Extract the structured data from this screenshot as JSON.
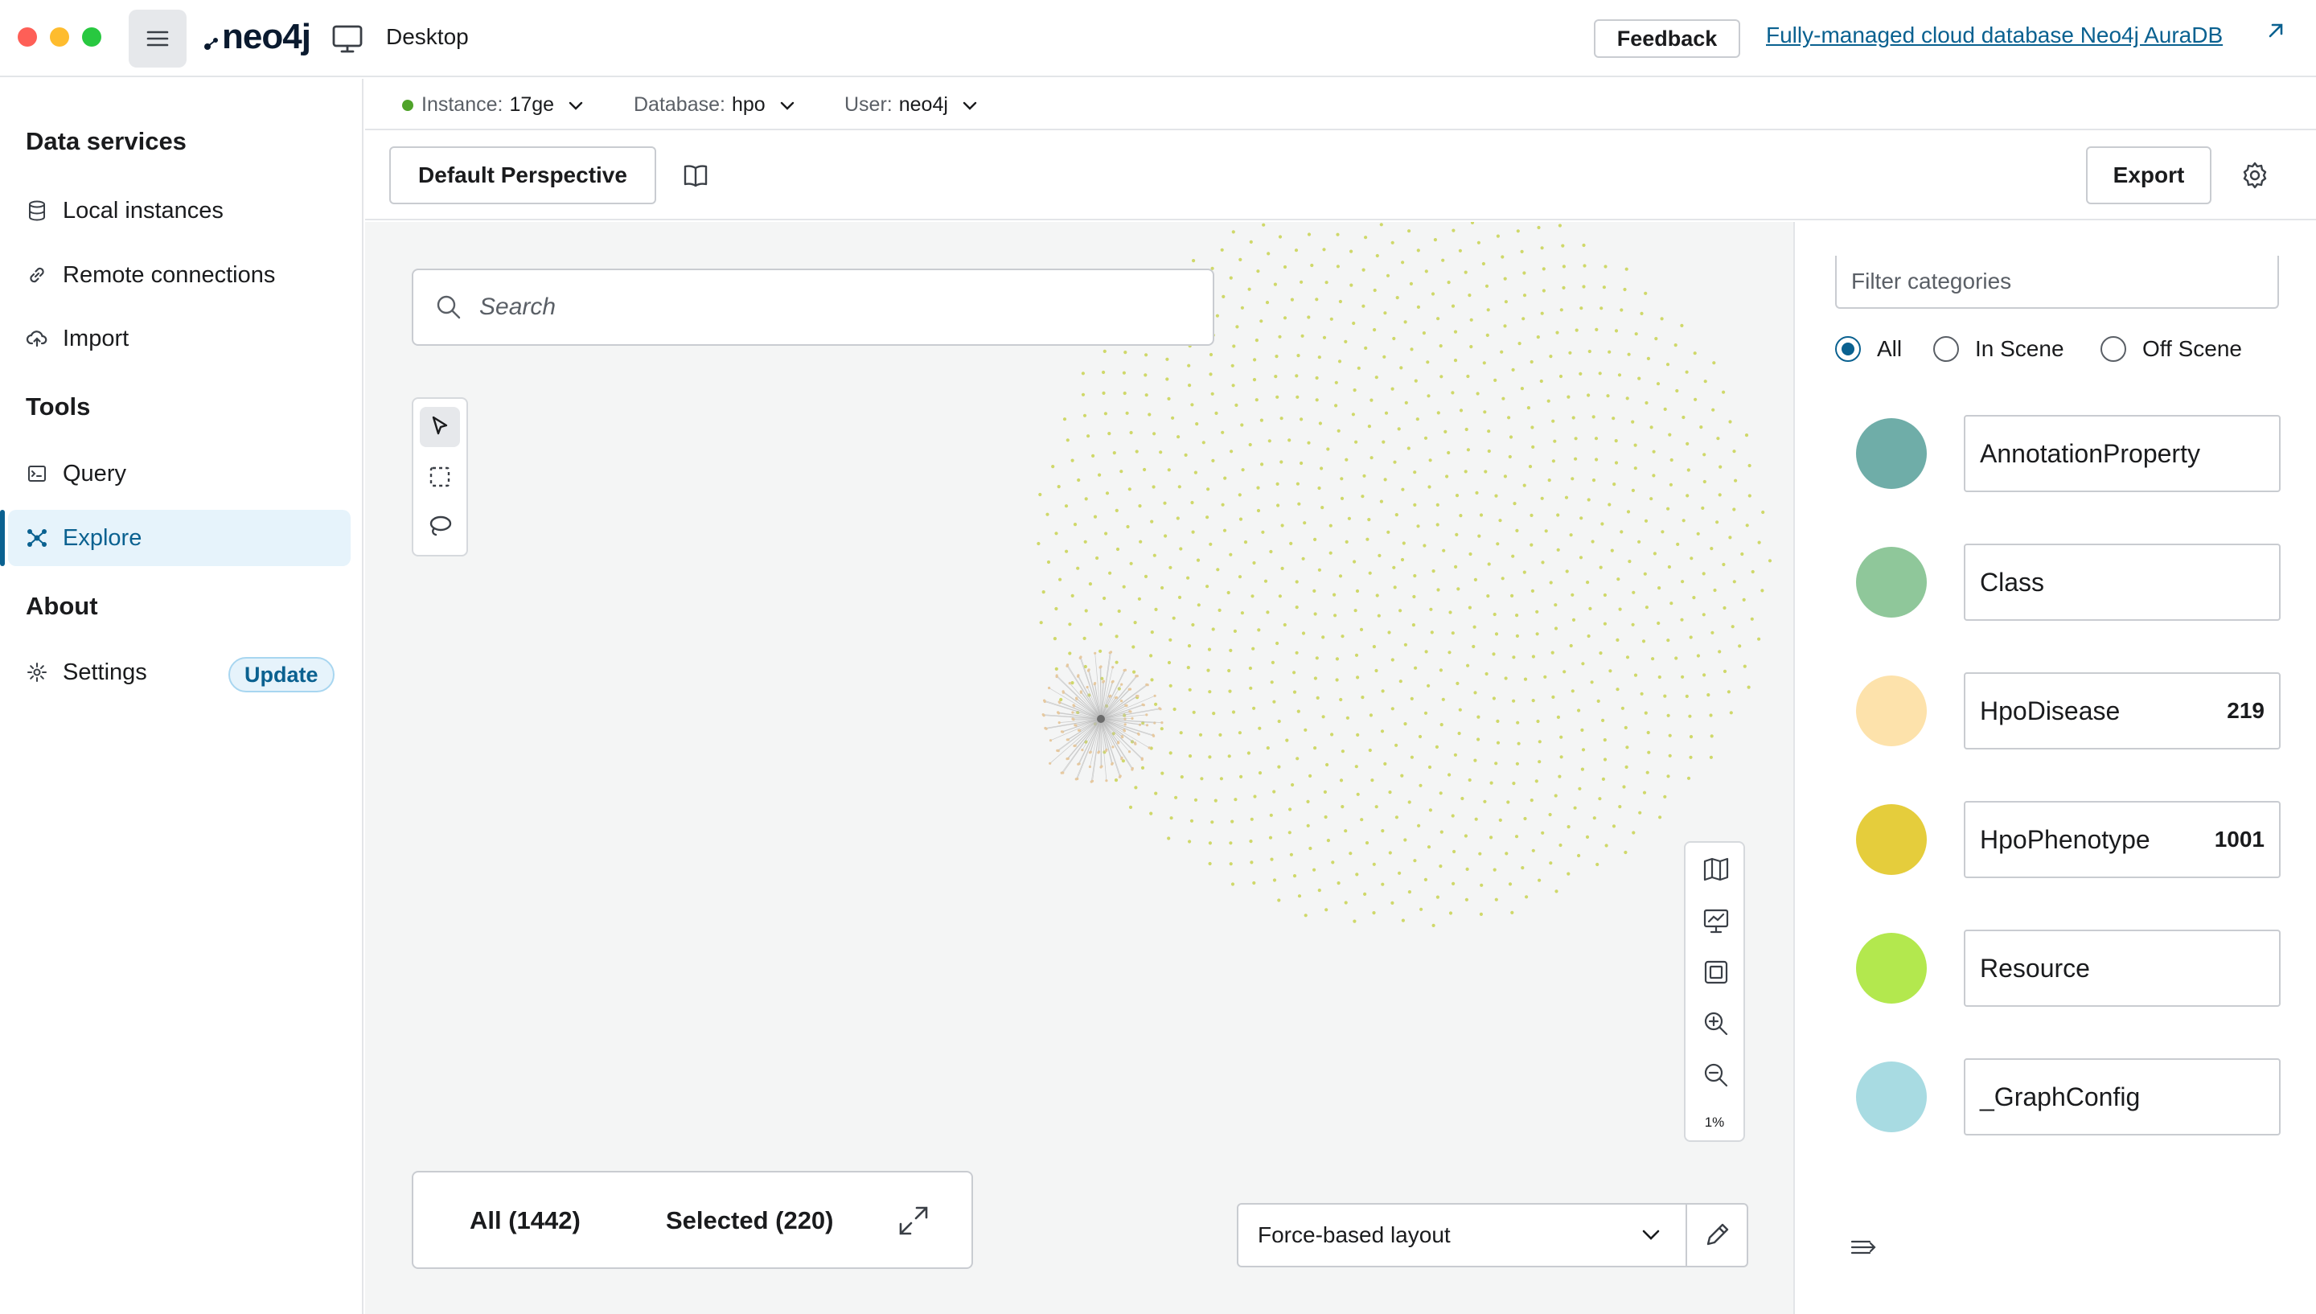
{
  "titlebar": {
    "app_name": "neo4j",
    "section_label": "Desktop",
    "feedback_label": "Feedback",
    "aura_link": "Fully-managed cloud database Neo4j AuraDB"
  },
  "sidebar": {
    "sections": [
      {
        "title": "Data services"
      },
      {
        "title": "Tools"
      },
      {
        "title": "About"
      }
    ],
    "items": [
      {
        "label": "Local instances",
        "icon": "database-icon"
      },
      {
        "label": "Remote connections",
        "icon": "link-icon"
      },
      {
        "label": "Import",
        "icon": "cloud-upload-icon"
      },
      {
        "label": "Query",
        "icon": "terminal-icon"
      },
      {
        "label": "Explore",
        "icon": "graph-icon",
        "active": true
      },
      {
        "label": "Settings",
        "icon": "gear-icon"
      }
    ],
    "update_badge": "Update"
  },
  "connection": {
    "instance_key": "Instance:",
    "instance_val": "17ge",
    "database_key": "Database:",
    "database_val": "hpo",
    "user_key": "User:",
    "user_val": "neo4j",
    "status_color": "#4fa32a"
  },
  "toolbar": {
    "perspective_label": "Default Perspective",
    "export_label": "Export"
  },
  "canvas": {
    "search_placeholder": "Search",
    "zoom_level": "1%",
    "count_all": "All (1442)",
    "count_selected": "Selected (220)",
    "layout_value": "Force-based layout"
  },
  "panel": {
    "filter_placeholder": "Filter categories",
    "radio_options": [
      {
        "label": "All",
        "checked": true
      },
      {
        "label": "In Scene",
        "checked": false
      },
      {
        "label": "Off Scene",
        "checked": false
      }
    ],
    "categories": [
      {
        "name": "AnnotationProperty",
        "count": "",
        "color": "#6fada8"
      },
      {
        "name": "Class",
        "count": "",
        "color": "#8fc79a"
      },
      {
        "name": "HpoDisease",
        "count": "219",
        "color": "#fde2ab"
      },
      {
        "name": "HpoPhenotype",
        "count": "1001",
        "color": "#e5cd3c"
      },
      {
        "name": "Resource",
        "count": "",
        "color": "#b3e84e"
      },
      {
        "name": "_GraphConfig",
        "count": "",
        "color": "#a8dbe2"
      }
    ]
  },
  "colors": {
    "accent": "#0a6190",
    "node_dot": "#cfd86a"
  }
}
